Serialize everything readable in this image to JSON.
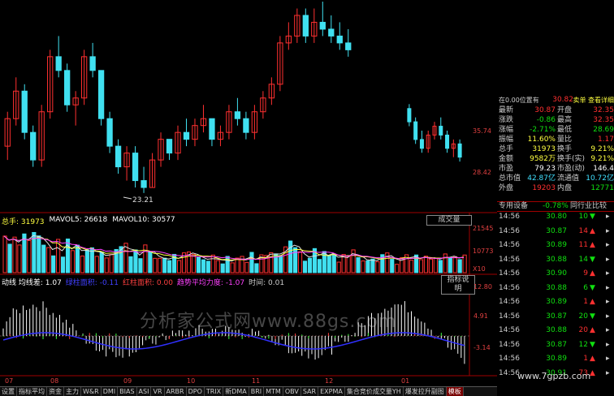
{
  "colors": {
    "up": "#ff3030",
    "down": "#40e0f0",
    "ma1": "#e0e0e0",
    "ma2": "#ffff40",
    "ma3": "#ff40ff",
    "grid": "#a00000"
  },
  "price_chart": {
    "low_label": "23.21",
    "axis_labels": [
      "35.74",
      "28.42"
    ],
    "candles": [
      [
        30,
        35,
        28,
        34
      ],
      [
        34,
        40,
        33,
        38
      ],
      [
        38,
        39,
        31,
        32
      ],
      [
        32,
        33,
        27,
        28
      ],
      [
        28,
        36,
        27,
        35
      ],
      [
        35,
        44,
        34,
        43
      ],
      [
        43,
        46,
        40,
        41
      ],
      [
        41,
        42,
        35,
        36
      ],
      [
        36,
        38,
        33,
        37
      ],
      [
        37,
        44,
        36,
        43
      ],
      [
        43,
        45,
        40,
        41
      ],
      [
        41,
        41,
        33,
        34
      ],
      [
        34,
        35,
        29,
        30
      ],
      [
        30,
        31,
        26,
        27
      ],
      [
        27,
        30,
        25,
        29
      ],
      [
        29,
        30,
        24,
        25
      ],
      [
        25,
        27,
        23.2,
        24
      ],
      [
        24,
        29,
        24,
        28
      ],
      [
        28,
        32,
        27,
        31
      ],
      [
        31,
        31,
        28,
        29
      ],
      [
        29,
        33,
        28,
        32
      ],
      [
        32,
        34,
        30,
        31
      ],
      [
        31,
        34,
        30,
        33
      ],
      [
        33,
        36,
        32,
        34
      ],
      [
        34,
        34,
        30,
        31
      ],
      [
        31,
        33,
        30,
        32
      ],
      [
        32,
        36,
        31,
        35
      ],
      [
        35,
        37,
        33,
        34
      ],
      [
        34,
        35,
        31,
        32
      ],
      [
        32,
        36,
        31,
        35
      ],
      [
        35,
        38,
        34,
        37
      ],
      [
        37,
        40,
        36,
        39
      ],
      [
        39,
        46,
        38,
        45
      ],
      [
        45,
        48,
        44,
        46
      ],
      [
        46,
        50,
        45,
        49
      ],
      [
        49,
        50,
        45,
        46
      ],
      [
        46,
        50,
        45,
        48
      ],
      [
        48,
        51,
        46,
        47
      ],
      [
        47,
        49,
        45,
        46
      ],
      [
        46,
        48,
        44,
        45
      ],
      [
        45,
        47,
        43,
        44
      ]
    ],
    "candles2": [
      [
        40,
        41,
        36,
        37
      ],
      [
        37,
        38,
        32,
        33
      ],
      [
        33,
        35,
        30,
        31
      ],
      [
        31,
        35,
        30,
        34
      ],
      [
        34,
        37,
        33,
        36
      ],
      [
        36,
        38,
        33,
        34
      ],
      [
        34,
        35,
        30,
        31
      ],
      [
        31,
        33,
        29,
        32
      ],
      [
        32,
        33,
        28,
        29
      ]
    ]
  },
  "volume_chart": {
    "info": {
      "hand_label": "总手: 31973",
      "mavol5_label": "MAVOL5: 26618",
      "mavol10_label": "MAVOL10: 30577"
    },
    "button": "成交量",
    "axis_labels": [
      "21545",
      "10773",
      "X10"
    ]
  },
  "indicator": {
    "info": [
      {
        "text": "动线 均线差: 1.07",
        "color": "#ffffff"
      },
      {
        "text": "绿柱面积: -0.11",
        "color": "#4040ff"
      },
      {
        "text": "红柱面积: 0.00",
        "color": "#ff4040"
      },
      {
        "text": "趋势平均力度: -1.07",
        "color": "#ff40ff"
      },
      {
        "text": "时间: 0.01",
        "color": "#cccccc"
      }
    ],
    "button": "指标说明",
    "axis_labels": [
      "12.80",
      "4.91",
      "-3.14"
    ]
  },
  "x_axis_labels": [
    "07",
    "08",
    "09",
    "10",
    "11",
    "12",
    "01"
  ],
  "tabs": [
    "设置",
    "指标平均",
    "资金",
    "主力",
    "W&R",
    "DMI",
    "BIAS",
    "ASI",
    "VR",
    "ARBR",
    "DPO",
    "TRIX",
    "新DMA",
    "BRI",
    "MTM",
    "OBV",
    "SAR",
    "EXPMA",
    "集合竞价成交量YH",
    "爆发拉升副图",
    "模板"
  ],
  "panel": {
    "header_left": "在0.00位置有",
    "header_right": "卖单 查看详细",
    "price_top": "30.82",
    "stats": [
      {
        "k1": "最新",
        "v1": "30.87",
        "c1": "red",
        "k2": "开盘",
        "v2": "32.35",
        "c2": "red"
      },
      {
        "k1": "涨跌",
        "v1": "-0.86",
        "c1": "grn",
        "k2": "最高",
        "v2": "32.35",
        "c2": "red"
      },
      {
        "k1": "涨幅",
        "v1": "-2.71%",
        "c1": "grn",
        "k2": "最低",
        "v2": "28.69",
        "c2": "grn"
      },
      {
        "k1": "振幅",
        "v1": "11.60%",
        "c1": "yel",
        "k2": "量比",
        "v2": "1.17",
        "c2": "red"
      },
      {
        "k1": "总手",
        "v1": "31973",
        "c1": "yel",
        "k2": "换手",
        "v2": "9.21%",
        "c2": "yel"
      },
      {
        "k1": "金额",
        "v1": "9582万",
        "c1": "yel",
        "k2": "换手(实)",
        "v2": "9.21%",
        "c2": "yel"
      },
      {
        "k1": "市盈",
        "v1": "79.23",
        "c1": "wht",
        "k2": "市盈(动)",
        "v2": "146.4",
        "c2": "wht"
      },
      {
        "k1": "总市值",
        "v1": "42.87亿",
        "c1": "cyn",
        "k2": "流通值",
        "v2": "10.72亿",
        "c2": "cyn"
      },
      {
        "k1": "外盘",
        "v1": "19203",
        "c1": "red",
        "k2": "内盘",
        "v2": "12771",
        "c2": "grn"
      }
    ],
    "footer_left": "专用设备",
    "footer_mid": "-0.78%",
    "footer_right": "同行业比较",
    "ticks": [
      {
        "t": "14:56",
        "p": "30.80",
        "v": "10",
        "d": "down"
      },
      {
        "t": "14:56",
        "p": "30.87",
        "v": "14",
        "d": "up"
      },
      {
        "t": "14:56",
        "p": "30.89",
        "v": "11",
        "d": "up"
      },
      {
        "t": "14:56",
        "p": "30.88",
        "v": "14",
        "d": "down"
      },
      {
        "t": "14:56",
        "p": "30.90",
        "v": "9",
        "d": "up"
      },
      {
        "t": "14:56",
        "p": "30.88",
        "v": "6",
        "d": "down"
      },
      {
        "t": "14:56",
        "p": "30.89",
        "v": "1",
        "d": "up"
      },
      {
        "t": "14:56",
        "p": "30.87",
        "v": "20",
        "d": "down"
      },
      {
        "t": "14:56",
        "p": "30.88",
        "v": "20",
        "d": "up"
      },
      {
        "t": "14:56",
        "p": "30.87",
        "v": "12",
        "d": "down"
      },
      {
        "t": "14:56",
        "p": "30.89",
        "v": "1",
        "d": "up"
      },
      {
        "t": "14:56",
        "p": "30.91",
        "v": "73",
        "d": "up"
      }
    ]
  },
  "watermarks": [
    "分析家公式网www.88gs.com",
    "www.7gpzb.com"
  ]
}
